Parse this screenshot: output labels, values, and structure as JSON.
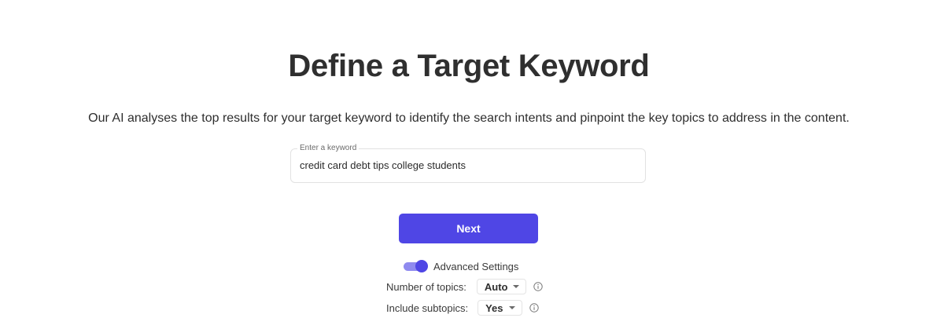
{
  "header": {
    "title": "Define a Target Keyword",
    "subtitle": "Our AI analyses the top results for your target keyword to identify the search intents and pinpoint the key topics to address in the content."
  },
  "keyword": {
    "legend": "Enter a keyword",
    "value": "credit card debt tips college students"
  },
  "next_button": {
    "label": "Next",
    "color": "#4f46e5"
  },
  "advanced": {
    "label": "Advanced Settings",
    "enabled": true,
    "settings": [
      {
        "label": "Number of topics:",
        "value": "Auto",
        "icon": "info-icon"
      },
      {
        "label": "Include subtopics:",
        "value": "Yes",
        "icon": "info-icon"
      }
    ]
  }
}
